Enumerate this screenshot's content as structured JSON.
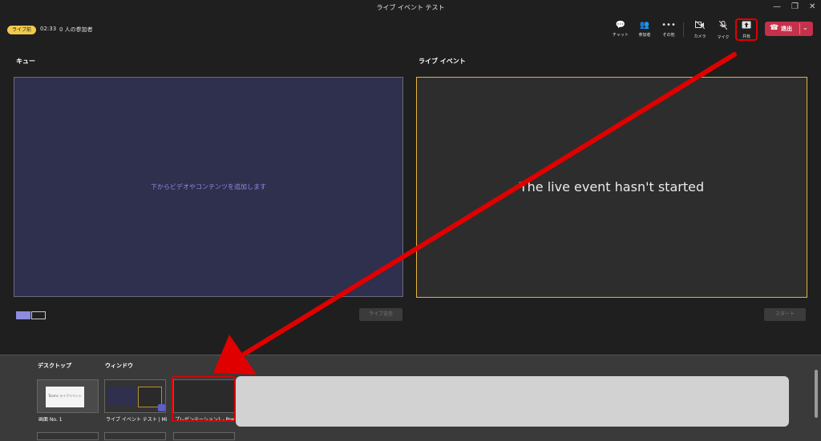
{
  "window": {
    "title": "ライブ イベント テスト",
    "minimize": "—",
    "restore": "❐",
    "close": "✕"
  },
  "status": {
    "badge": "ライブ前",
    "timer": "02:33",
    "participants": "0 人の参加者"
  },
  "toolbar": {
    "chat": {
      "icon": "chat-icon",
      "label": "チャット"
    },
    "people": {
      "icon": "people-icon",
      "label": "参加者"
    },
    "more": {
      "icon": "more-icon",
      "label": "その他"
    },
    "camera": {
      "icon": "camera-icon",
      "label": "カメラ"
    },
    "mic": {
      "icon": "mic-off-icon",
      "label": "マイク"
    },
    "share": {
      "icon": "share-icon",
      "label": "共有"
    },
    "leave": {
      "label": "退出"
    }
  },
  "queue": {
    "title": "キュー",
    "placeholder": "下からビデオやコンテンツを追加します",
    "send_button": "ライブ送信"
  },
  "live": {
    "title": "ライブ イベント",
    "status": "The live event hasn't started",
    "start_button": "スタート"
  },
  "tray": {
    "desktop_label": "デスクトップ",
    "window_label": "ウィンドウ",
    "desktop_items": [
      {
        "caption": "画面 No. 1",
        "preview_text": "Teams ライブイベント"
      }
    ],
    "window_items": [
      {
        "caption": "ライブ イベント テスト | Micr..."
      },
      {
        "caption": "プレゼンテーション1 - Power..."
      }
    ]
  },
  "colors": {
    "accent": "#8c8ce0",
    "live_border": "#e6b43a",
    "leave": "#c4314b",
    "annotation": "#e00000"
  }
}
